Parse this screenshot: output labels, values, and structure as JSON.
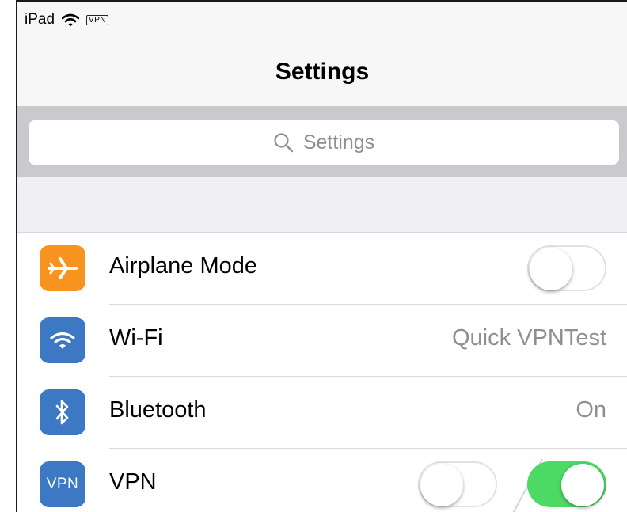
{
  "status_bar": {
    "device": "iPad",
    "vpn_badge": "VPN"
  },
  "nav": {
    "title": "Settings"
  },
  "search": {
    "placeholder": "Settings"
  },
  "rows": [
    {
      "label": "Airplane Mode",
      "icon": "airplane-icon",
      "icon_color": "#F7931E",
      "toggle": "off"
    },
    {
      "label": "Wi-Fi",
      "icon": "wifi-icon",
      "icon_color": "#3D78C4",
      "value": "Quick VPNTest"
    },
    {
      "label": "Bluetooth",
      "icon": "bluetooth-icon",
      "icon_color": "#3D78C4",
      "value": "On"
    },
    {
      "label": "VPN",
      "icon": "vpn-icon",
      "icon_text": "VPN",
      "icon_color": "#3D78C4",
      "toggle_states": [
        "off",
        "on"
      ]
    }
  ],
  "colors": {
    "toggle_on": "#4CD964",
    "nav_bg": "#F7F7F7",
    "search_bar_bg": "#C9C9CE"
  }
}
